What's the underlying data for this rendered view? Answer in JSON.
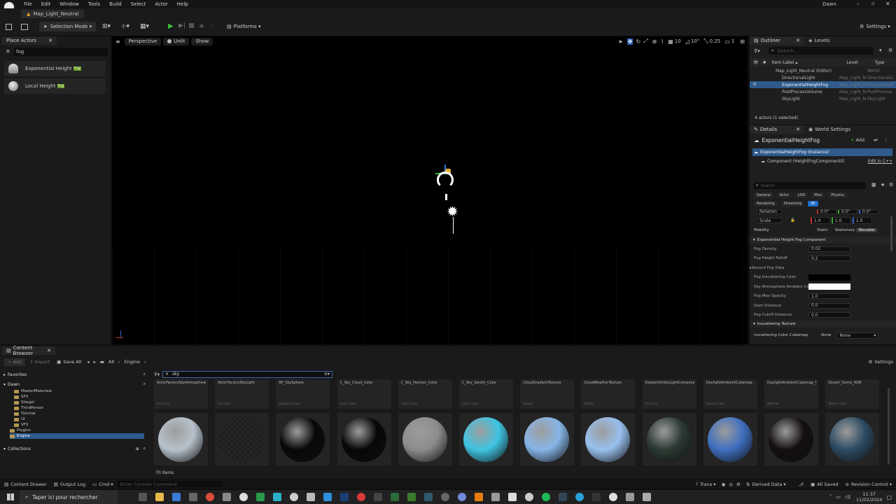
{
  "window": {
    "title": "Map_Light_Neutral",
    "user": "Dawn"
  },
  "menu": [
    "File",
    "Edit",
    "Window",
    "Tools",
    "Build",
    "Select",
    "Actor",
    "Help"
  ],
  "toolbar": {
    "selection_mode": "Selection Mode",
    "platforms": "Platforms",
    "settings": "Settings"
  },
  "viewport": {
    "perspective": "Perspective",
    "unlit": "Unlit",
    "show": "Show",
    "grid_size": "10",
    "rotation_snap": "10°",
    "scale_snap": "0.25",
    "camera_speed": "1"
  },
  "place_actors": {
    "tab": "Place Actors",
    "search": "fog",
    "items": [
      {
        "label": "Exponential Height",
        "badge": "Fog"
      },
      {
        "label": "Local Height",
        "badge": "Fog"
      }
    ]
  },
  "outliner": {
    "tab": "Outliner",
    "tab2": "Levels",
    "search_placeholder": "Search...",
    "col_label": "Item Label ▴",
    "col_level": "Level",
    "col_type": "Type",
    "rows": [
      {
        "label": "Map_Light_Neutral (Editor)",
        "level": "",
        "type": "World",
        "indent": 1,
        "selected": false
      },
      {
        "label": "DirectionalLight",
        "level": "Map_Light_N",
        "type": "DirectionalLi",
        "indent": 2,
        "selected": false
      },
      {
        "label": "ExponentialHeightFog",
        "level": "Map_Light_N",
        "type": "ExponentialH",
        "indent": 2,
        "selected": true
      },
      {
        "label": "PostProcessVolume",
        "level": "Map_Light_N",
        "type": "PostProcess",
        "indent": 2,
        "selected": false
      },
      {
        "label": "SkyLight",
        "level": "Map_Light_N",
        "type": "SkyLight",
        "indent": 2,
        "selected": false
      }
    ],
    "footer": "4 actors (1 selected)"
  },
  "details": {
    "tab": "Details",
    "tab2": "World Settings",
    "actor": "ExponentialHeightFog",
    "add": "Add",
    "instance": "ExponentialHeightFog (Instance)",
    "component": "Component (HeightFogComponent0)",
    "edit_cpp": "Edit in C++",
    "search_placeholder": "Search",
    "filters": [
      "General",
      "Actor",
      "LOD",
      "Misc",
      "Physics",
      "Rendering",
      "Streaming",
      "All"
    ],
    "rotation_label": "Rotation",
    "rotation_vals": [
      "0.0°",
      "0.0°",
      "0.0°"
    ],
    "scale_label": "Scale",
    "scale_vals": [
      "1.0",
      "1.0",
      "1.0"
    ],
    "mobility_label": "Mobility",
    "mobility": [
      "Static",
      "Stationary",
      "Movable"
    ],
    "section": "Exponential Height Fog Component",
    "props": [
      {
        "label": "Fog Density",
        "value": "0.02",
        "kind": "num"
      },
      {
        "label": "Fog Height Falloff",
        "value": "0.2",
        "kind": "num"
      },
      {
        "label": "Second Fog Data",
        "value": "",
        "kind": "group"
      },
      {
        "label": "Fog Inscattering Color",
        "value": "",
        "kind": "black"
      },
      {
        "label": "Sky Atmosphere Ambient Co...",
        "value": "",
        "kind": "white"
      },
      {
        "label": "Fog Max Opacity",
        "value": "1.0",
        "kind": "num"
      },
      {
        "label": "Start Distance",
        "value": "0.0",
        "kind": "num"
      },
      {
        "label": "Fog Cutoff Distance",
        "value": "0.0",
        "kind": "num"
      }
    ],
    "section2": "Inscattering Texture",
    "cubemap_label": "Inscattering Color Cubemap",
    "cubemap_value": "None",
    "cubemap_none": "None"
  },
  "content_browser": {
    "tab": "Content Browser",
    "add": "Add",
    "import": "Import",
    "save_all": "Save All",
    "path": [
      "All",
      "Engine"
    ],
    "settings": "Settings",
    "search": "sky",
    "favorites": "Favorites",
    "root": "Dawn",
    "folders": [
      "MasterMaterials",
      "SFX",
      "Stiegel",
      "ThirdPerson",
      "Tutorial",
      "UI",
      "VFX",
      "Plugins",
      "Engine"
    ],
    "collections": "Collections",
    "count": "70 items",
    "top_cards": [
      {
        "name": "ActorFactorySkyAtmosphere",
        "type": "Ent Class"
      },
      {
        "name": "ActorFactorySkyLight",
        "type": "Ent Class"
      },
      {
        "name": "BP_SkySphere",
        "type": "Blueprint Class"
      },
      {
        "name": "C_Sky_Cloud_Color",
        "type": "Color Curve"
      },
      {
        "name": "C_Sky_Horizon_Color",
        "type": "Color Curve"
      },
      {
        "name": "C_Sky_Zenith_Color",
        "type": "Color Curve"
      },
      {
        "name": "CloudGradientTexture",
        "type": "Texture"
      },
      {
        "name": "CloudWeatherTexture",
        "type": "Texture"
      },
      {
        "name": "DatasmithSkyLightComponentTemplate",
        "type": "Ent Class"
      },
      {
        "name": "DaylightAmbientCubemap",
        "type": "Texture Cube"
      },
      {
        "name": "DaylightAmbientCubemap_Mat",
        "type": "Material"
      },
      {
        "name": "Desert_Dome_HDR",
        "type": "Texture Cube"
      }
    ],
    "spheres": [
      "#b7c2cc",
      "#1b1b1b",
      "#080808",
      "#070707",
      "#8c8c8c",
      "#3fc4e2",
      "#87b5e8",
      "#98c0ee",
      "#2c3a33",
      "#3f6fc0",
      "#140f0f",
      "#2d4b63"
    ]
  },
  "statusbar": {
    "content_drawer": "Content Drawer",
    "output_log": "Output Log",
    "cmd": "Cmd",
    "console_placeholder": "Enter Console Command",
    "trace": "Trace",
    "derived": "Derived Data",
    "all_saved": "All Saved",
    "revision": "Revision Control"
  },
  "taskbar": {
    "search": "Taper ici pour rechercher",
    "time": "11:37",
    "date": "11/02/2024"
  }
}
